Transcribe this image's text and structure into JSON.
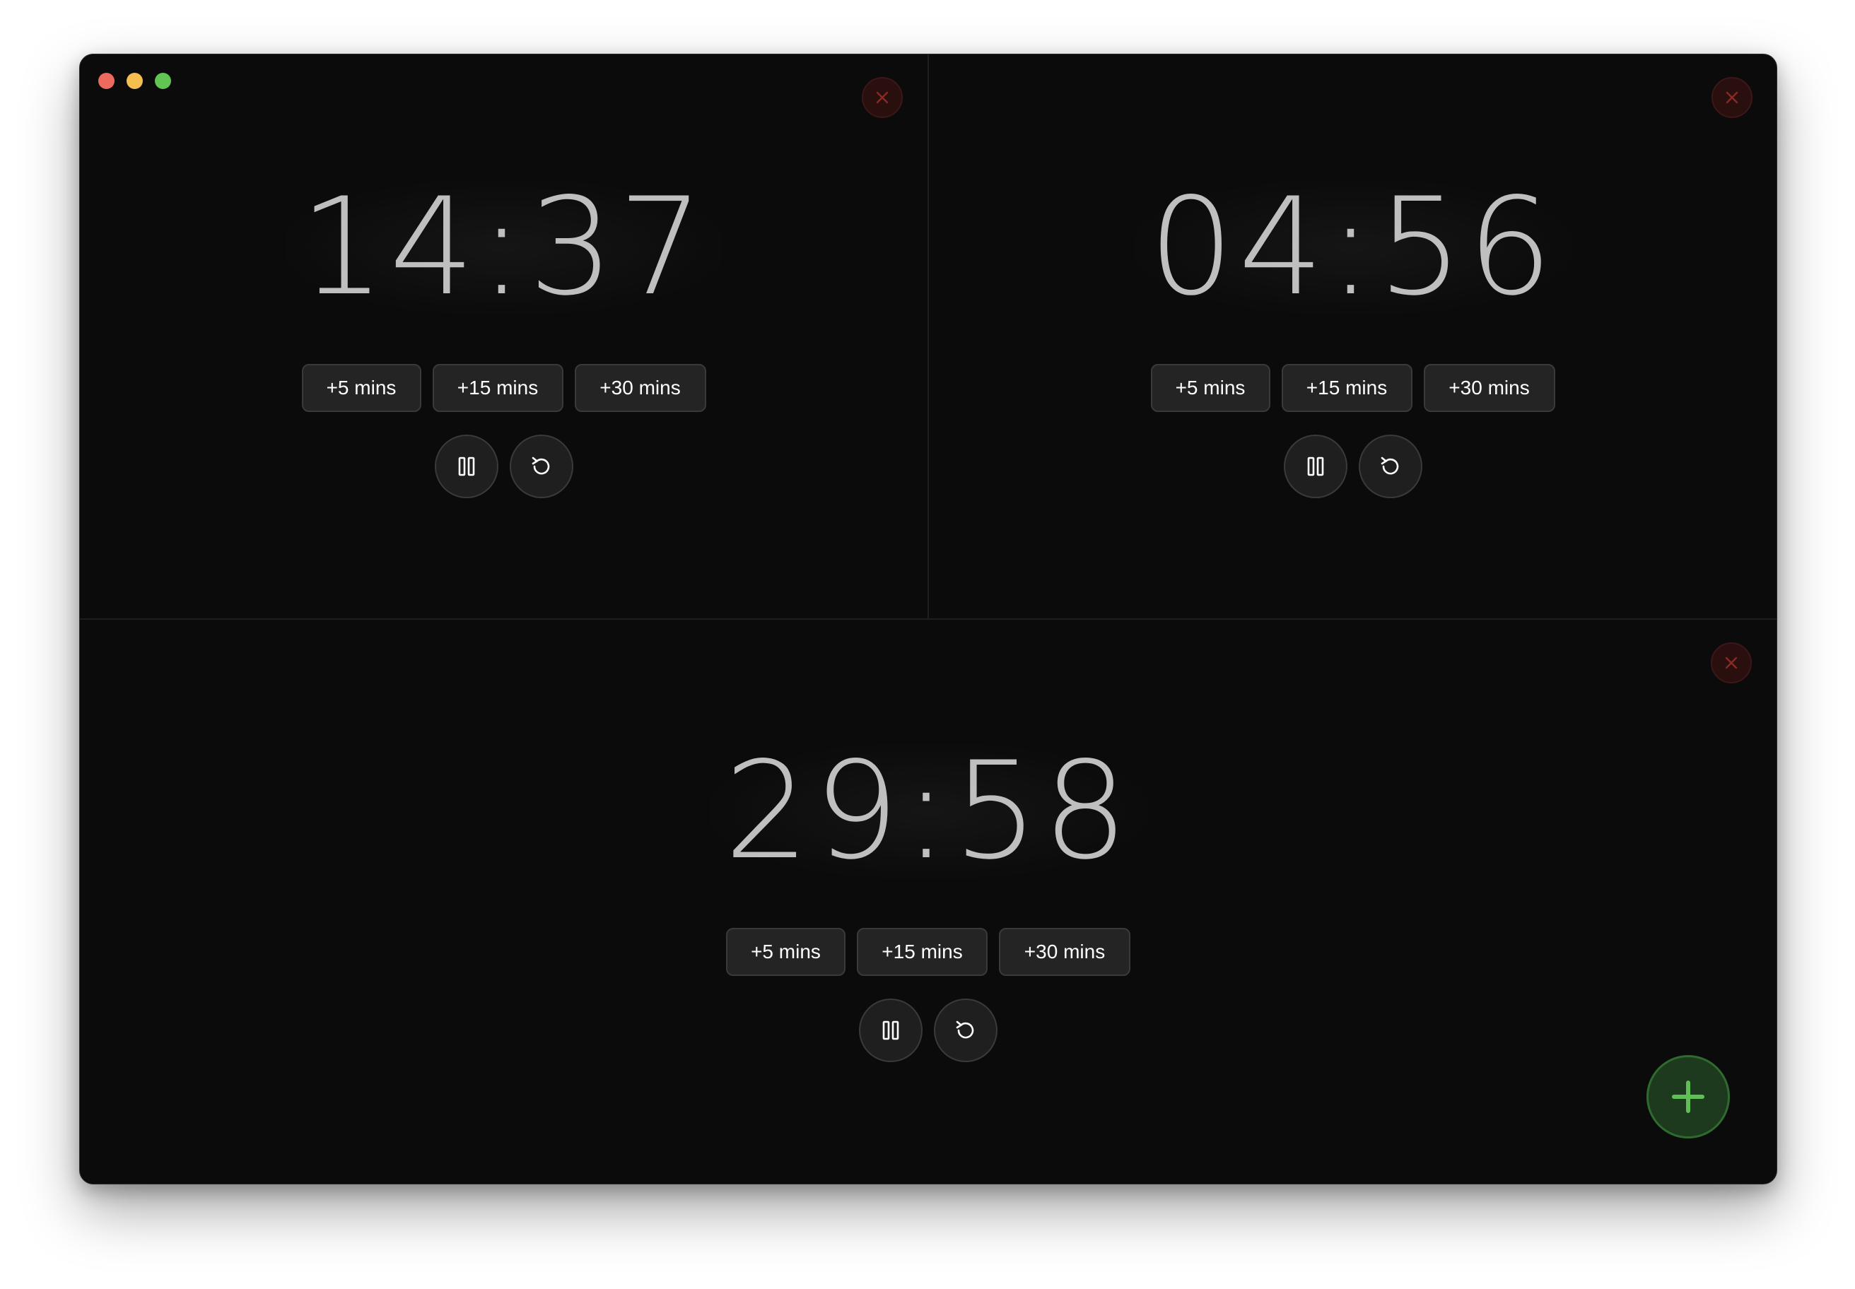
{
  "colors": {
    "close_icon": "#8a2a22",
    "fab_icon": "#5fbf55",
    "time_text": "#bfbfbf"
  },
  "timers": [
    {
      "time": "14:37",
      "add_buttons": [
        "+5 mins",
        "+15 mins",
        "+30 mins"
      ],
      "icons": [
        "close-icon",
        "pause-icon",
        "reset-icon"
      ]
    },
    {
      "time": "04:56",
      "add_buttons": [
        "+5 mins",
        "+15 mins",
        "+30 mins"
      ],
      "icons": [
        "close-icon",
        "pause-icon",
        "reset-icon"
      ]
    },
    {
      "time": "29:58",
      "add_buttons": [
        "+5 mins",
        "+15 mins",
        "+30 mins"
      ],
      "icons": [
        "close-icon",
        "pause-icon",
        "reset-icon"
      ]
    }
  ],
  "fab": {
    "icon": "plus-icon"
  }
}
